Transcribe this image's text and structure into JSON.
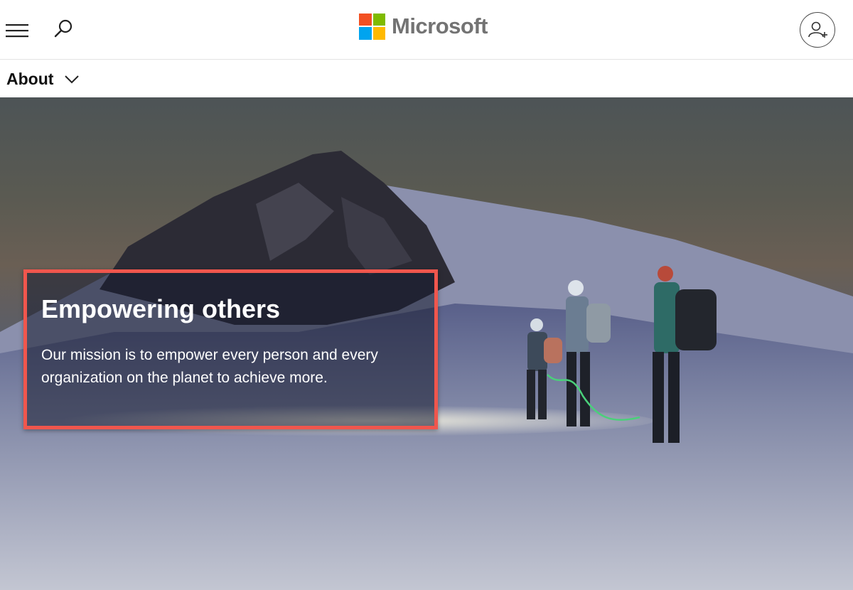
{
  "brand": {
    "name": "Microsoft",
    "logo_colors": [
      "#f25022",
      "#7fba00",
      "#00a4ef",
      "#ffb900"
    ]
  },
  "header": {
    "menu_icon": "hamburger-menu-icon",
    "search_icon": "search-icon",
    "account_icon": "add-account-icon"
  },
  "subnav": {
    "label": "About",
    "chevron_icon": "chevron-down-icon"
  },
  "hero": {
    "title": "Empowering others",
    "text": "Our mission is to empower every person and every organization on the planet to achieve more.",
    "highlight_color": "#f0564d"
  }
}
